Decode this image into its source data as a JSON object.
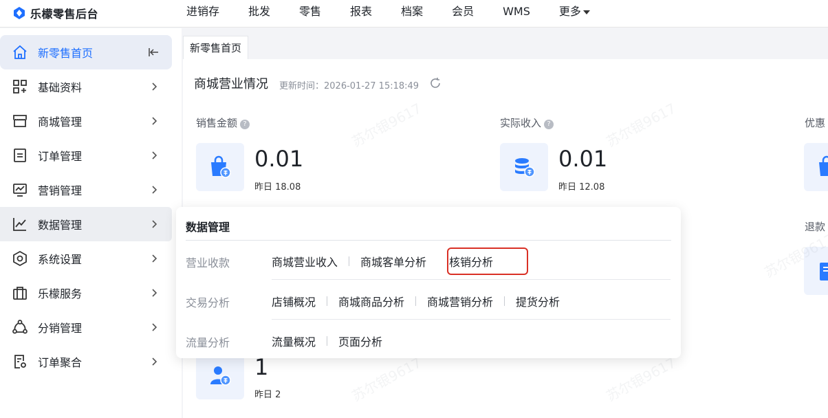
{
  "brand": {
    "name": "乐檬零售后台"
  },
  "topnav": [
    "进销存",
    "批发",
    "零售",
    "报表",
    "档案",
    "会员",
    "WMS",
    "更多"
  ],
  "sidebar": {
    "items": [
      {
        "label": "新零售首页"
      },
      {
        "label": "基础资料"
      },
      {
        "label": "商城管理"
      },
      {
        "label": "订单管理"
      },
      {
        "label": "营销管理"
      },
      {
        "label": "数据管理"
      },
      {
        "label": "系统设置"
      },
      {
        "label": "乐檬服务"
      },
      {
        "label": "分销管理"
      },
      {
        "label": "订单聚合"
      }
    ]
  },
  "tab": {
    "label": "新零售首页"
  },
  "overview": {
    "title": "商城营业情况",
    "update_time": "更新时间：2026-01-27 15:18:49",
    "metrics": [
      {
        "label": "销售金额",
        "value": "0.01",
        "yesterday": "昨日 18.08"
      },
      {
        "label": "实际收入",
        "value": "0.01",
        "yesterday": "昨日 12.08"
      },
      {
        "label": "优惠"
      },
      {
        "label": "退款"
      },
      {
        "value": "1",
        "yesterday": "昨日 2"
      }
    ]
  },
  "popup": {
    "title": "数据管理",
    "rows": [
      {
        "label": "营业收款",
        "links": [
          "商城营业收入",
          "商城客单分析",
          "核销分析"
        ]
      },
      {
        "label": "交易分析",
        "links": [
          "店铺概况",
          "商城商品分析",
          "商城营销分析",
          "提货分析"
        ]
      },
      {
        "label": "流量分析",
        "links": [
          "流量概况",
          "页面分析"
        ]
      }
    ]
  },
  "watermark": "苏尔银9617",
  "colors": {
    "accent": "#1e6fff",
    "highlight": "#d93025",
    "icon_bg": "#eef3fd"
  }
}
